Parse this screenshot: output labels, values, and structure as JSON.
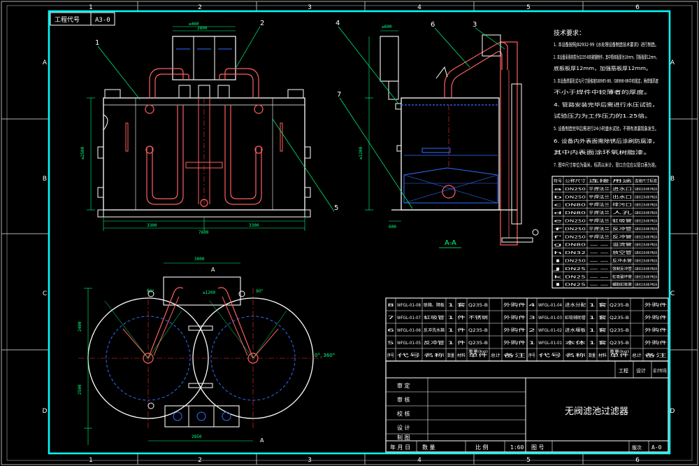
{
  "grid": {
    "cols": [
      "1",
      "2",
      "3",
      "4",
      "5",
      "6"
    ],
    "rows": [
      "A",
      "B",
      "C",
      "D"
    ]
  },
  "code_block": {
    "label": "工程代号",
    "value": "A3-0"
  },
  "section_label": "A-A",
  "leaders": [
    "1",
    "2",
    "3",
    "4",
    "5",
    "6",
    "7"
  ],
  "view_marks": {
    "a_top": "A",
    "a_bottom": "A",
    "angle_right": "0°, 360°",
    "angle_a": "90°",
    "angle_b": "90°"
  },
  "dims": {
    "front": [
      "≥460",
      "2500",
      "≥2500",
      "7600",
      "3300",
      "3300",
      "2800",
      "300",
      "400"
    ],
    "side": [
      "≥600",
      "≥1200",
      "600",
      "460"
    ],
    "plan": [
      "3000",
      "≥1200",
      "2400",
      "2500",
      "1290",
      "2850",
      "900"
    ]
  },
  "notes": {
    "title": "技术要求：",
    "items": [
      "1.  本设备按照JB2932-99《水处理设备制造技术要求》进行制造。",
      "2.  本设备采用材质为Q235-B的碳钢制作，其中筒体板厚为10mm，顶板板厚12mm，",
      "    底板板厚12mm，加强筋板厚12mm。",
      "3.  本设备焊接形式与尺寸规格按GB985-88、GB986-88中的规定，角焊缝高度",
      "    不小于焊件中较薄者的厚度。",
      "4.  管路安装完毕后需进行水压试验，",
      "    试验压力为工作压力的1.25倍。",
      "5.  设备制造完毕后需进行24小时盛水试验，不得有渗漏现象发生。",
      "6.  设备内外表面需除锈后涂刷防腐漆，",
      "    其中内表面涂环氧树脂漆。",
      "7.  图中尺寸单位为毫米，标高以米计，管口方位应以管口表为准。"
    ]
  },
  "nozzle_table": {
    "headers": [
      "符号",
      "公称尺寸",
      "连接",
      "用途",
      "连接尺寸标准"
    ],
    "rows": [
      [
        "a",
        "DN250",
        "平焊法兰",
        "进水口",
        "GB9119-88 PN16"
      ],
      [
        "b",
        "DN250",
        "平焊法兰",
        "出水口",
        "GB9119-88 PN16"
      ],
      [
        "c",
        "DN80",
        "平焊法兰",
        "排污口",
        "GB9119-88 PN16"
      ],
      [
        "d",
        "DN80",
        "平焊法兰",
        "人孔",
        "GB9119-88 PN16"
      ],
      [
        "e",
        "DN250",
        "平焊法兰",
        "虹吸管",
        "GB9119-88 PN16"
      ],
      [
        "f",
        "DN250",
        "平焊法兰",
        "反冲管",
        "GB9119-88 PN16"
      ],
      [
        "f'",
        "DN250",
        "平焊法兰",
        "反冲管",
        "GB9119-88 PN16"
      ],
      [
        "g",
        "DN80",
        "--",
        "溢流管",
        "GB9119-88 PN16"
      ],
      [
        "h",
        "DN32",
        "--",
        "放空管",
        "GB9119-88 PN16"
      ],
      [
        "i",
        "DN250",
        "--",
        "反冲水管",
        "GB9119-88 PN16"
      ],
      [
        "j",
        "DN25",
        "--",
        "强制反冲管",
        "GB9119-88 PN16"
      ],
      [
        "k",
        "DN25",
        "--",
        "虹吸破坏管",
        "GB9119-88 PN16"
      ],
      [
        "l",
        "DN25",
        "--",
        "辅助虹吸管",
        "GB9119-88 PN16"
      ]
    ]
  },
  "bom": {
    "headers": [
      "序号",
      "代号",
      "名称",
      "数量",
      "材料",
      "单件",
      "总计",
      "备注"
    ],
    "weight_label": "重量(kg)",
    "rows_left": [
      [
        "8",
        "WFGL-01-08",
        "联箱、隔板",
        "1",
        "套",
        "Q235-B",
        "",
        "外购件"
      ],
      [
        "7",
        "WFGL-01-07",
        "虹吸管",
        "1",
        "件",
        "不锈钢",
        "",
        "外购件"
      ],
      [
        "6",
        "WFGL-01-06",
        "反冲洗水箱",
        "1",
        "件",
        "Q235-B",
        "",
        "外购件"
      ],
      [
        "5",
        "WFGL-01-05",
        "反冲管",
        "1",
        "件",
        "Q235-B",
        "",
        "外购件"
      ]
    ],
    "rows_right": [
      [
        "4",
        "WFGL-01-04",
        "进水分配",
        "1",
        "套",
        "Q235-B",
        "",
        "外购件"
      ],
      [
        "3",
        "WFGL-01-03",
        "虹吸辅助管",
        "1",
        "套",
        "Q235-B",
        "",
        "外购件"
      ],
      [
        "2",
        "WFGL-01-02",
        "进水堰板",
        "1",
        "套",
        "Q235-B",
        "",
        "外购件"
      ],
      [
        "1",
        "WFGL-01-01",
        "本体",
        "1",
        "套",
        "Q235-B",
        "",
        "外购件"
      ]
    ]
  },
  "title_block": {
    "project_label": "工程",
    "design_label": "设计",
    "stage_label": "设计阶段",
    "roles": [
      "审 定",
      "审 核",
      "校 核",
      "设 计",
      "制 图"
    ],
    "drawing_title": "无阀滤池过滤器",
    "date_label": "年 月 日",
    "qty_label": "数 量",
    "scale_label": "比 例",
    "scale_value": "1:60",
    "drawing_no_label": "图 号",
    "version_label": "版次",
    "version_value": "A-0"
  },
  "colors": {
    "frame": "#00ffff",
    "outline": "#ffffff",
    "pipe": "#ff6060",
    "center": "#ff3030",
    "dim": "#00ff80",
    "hidden": "#3070ff",
    "accent": "#ffff00",
    "grid": "#b0b0b0"
  }
}
